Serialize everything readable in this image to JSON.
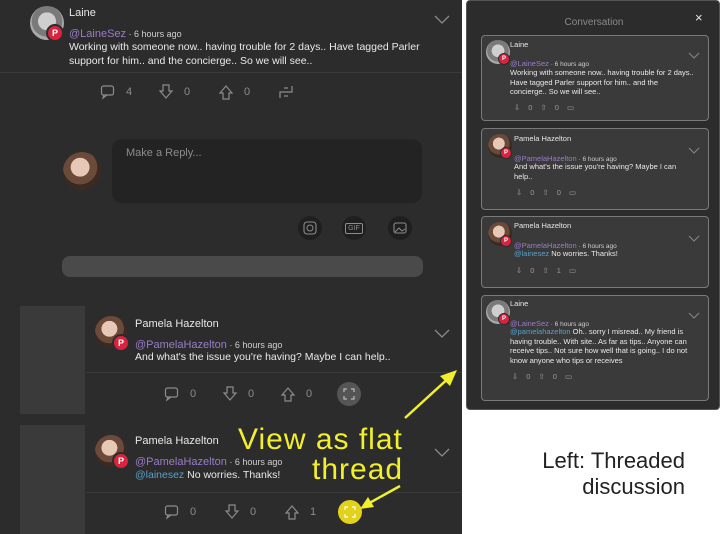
{
  "threaded": {
    "post1": {
      "user": "Laine",
      "handle": "@LaineSez",
      "time": "6 hours ago",
      "text": "Working with someone now.. having trouble for 2 days.. Have tagged Parler support for him.. and the concierge.. So we will see..",
      "counts": {
        "comments": "4",
        "downvotes": "0",
        "upvotes": "0"
      }
    },
    "reply_box": {
      "placeholder": "Make a Reply..."
    },
    "toolbar": {
      "gif_label": "GIF"
    },
    "post2": {
      "user": "Pamela Hazelton",
      "handle": "@PamelaHazelton",
      "time": "6 hours ago",
      "text": "And what's the issue you're having? Maybe I can help..",
      "counts": {
        "comments": "0",
        "downvotes": "0",
        "upvotes": "0"
      }
    },
    "post3": {
      "user": "Pamela Hazelton",
      "handle": "@PamelaHazelton",
      "time": "6 hours ago",
      "mention": "@lainesez",
      "text": " No worries. Thanks!",
      "counts": {
        "comments": "0",
        "downvotes": "0",
        "upvotes": "1"
      }
    },
    "sep": " · "
  },
  "annotation": {
    "line1": "View as flat",
    "line2": "thread",
    "color": "#f2ef2b"
  },
  "caption": {
    "line1": "Left: Threaded",
    "line2": "discussion"
  },
  "conversation": {
    "title": "Conversation",
    "close": "×",
    "cards": [
      {
        "user": "Laine",
        "handle": "@LaineSez",
        "time": "6 hours ago",
        "mention": "",
        "text": "Working with someone now.. having trouble for 2 days.. Have tagged Parler support for him.. and the concierge.. So we will see..",
        "down": "0",
        "up": "0"
      },
      {
        "user": "Pamela Hazelton",
        "handle": "@PamelaHazelton",
        "time": "6 hours ago",
        "mention": "",
        "text": "And what's the issue you're having? Maybe I can help..",
        "down": "0",
        "up": "0"
      },
      {
        "user": "Pamela Hazelton",
        "handle": "@PamelaHazelton",
        "time": "6 hours ago",
        "mention": "@lainesez",
        "text": " No worries. Thanks!",
        "down": "0",
        "up": "1"
      },
      {
        "user": "Laine",
        "handle": "@LaineSez",
        "time": "6 hours ago",
        "mention": "@pamelahazelton",
        "text": " Oh.. sorry I misread.. My friend is having trouble.. With site.. As far as tips.. Anyone can receive tips.. Not sure how well that is going.. I do not know anyone who tips or receives",
        "down": "0",
        "up": "0"
      }
    ]
  },
  "colors": {
    "accent_yellow": "#f2ef2b",
    "parler_red": "#d9233f",
    "handle_purple": "#9a7cc8",
    "mention_blue": "#5aa0c8"
  }
}
